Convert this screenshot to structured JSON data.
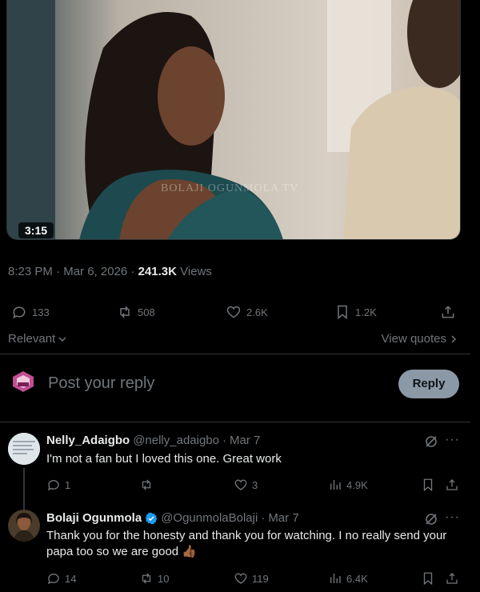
{
  "video": {
    "duration": "3:15",
    "watermark": "BOLAJI OGUNMOLA TV"
  },
  "post_meta": {
    "time": "8:23 PM",
    "date": "Mar 6, 2026",
    "views_count": "241.3K",
    "views_label": "Views"
  },
  "post_actions": {
    "replies": "133",
    "reposts": "508",
    "likes": "2.6K",
    "bookmarks": "1.2K"
  },
  "sort": {
    "label": "Relevant",
    "view_quotes": "View quotes"
  },
  "composer": {
    "placeholder": "Post your reply",
    "button": "Reply"
  },
  "replies": [
    {
      "name": "Nelly_Adaigbo",
      "handle": "@nelly_adaigbo",
      "date": "Mar 7",
      "text": "I'm not a fan but I loved this one. Great work",
      "replies": "1",
      "reposts": "",
      "likes": "3",
      "views": "4.9K"
    },
    {
      "name": "Bolaji Ogunmola",
      "handle": "@OgunmolaBolaji",
      "date": "Mar 7",
      "text": "Thank you for the honesty and thank you for watching. I no really send your papa too so we are good 👍🏾",
      "replies": "14",
      "reposts": "10",
      "likes": "119",
      "views": "6.4K"
    }
  ],
  "colors": {
    "background": "#000000",
    "text_primary": "#e7e9ea",
    "text_secondary": "#71767b",
    "divider": "#2f3336",
    "verified": "#1d9bf0",
    "reply_button": "#8b98a5"
  }
}
